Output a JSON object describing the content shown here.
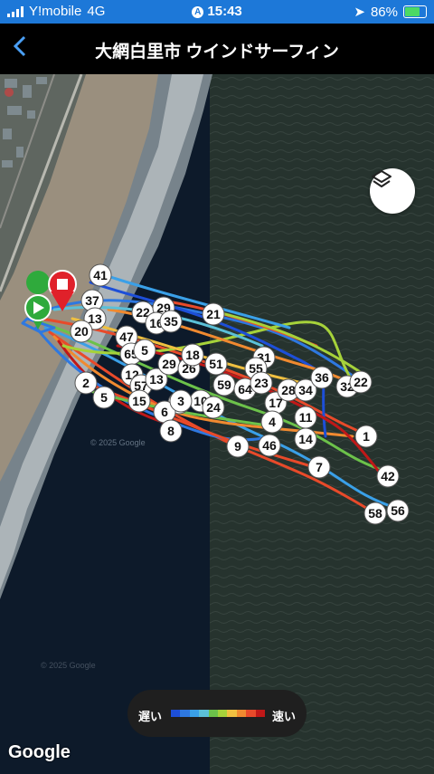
{
  "status": {
    "carrier": "Y!mobile",
    "network": "4G",
    "time": "15:43",
    "battery": "86%",
    "battery_level": 0.86
  },
  "nav": {
    "title": "大網白里市 ウインドサーフィン",
    "back_icon": "chevron-left-icon"
  },
  "legend": {
    "slow": "遅い",
    "fast": "速い",
    "colors": [
      "#1d4fd8",
      "#2e78e0",
      "#3aa0e8",
      "#5bc0d8",
      "#6cc24a",
      "#a6d23a",
      "#f0c040",
      "#f08a30",
      "#e84a2a",
      "#c01818"
    ]
  },
  "map": {
    "attribution": "Google",
    "layer_icon": "layers-icon",
    "start_icon": "play-flag-icon",
    "end_icon": "stop-flag-icon"
  },
  "lap_markers": [
    "41",
    "37",
    "13",
    "20",
    "22",
    "29",
    "16",
    "35",
    "21",
    "47",
    "65",
    "5",
    "2",
    "12",
    "57",
    "15",
    "13",
    "29",
    "26",
    "18",
    "51",
    "3",
    "10",
    "31",
    "55",
    "59",
    "64",
    "17",
    "23",
    "28",
    "34",
    "36",
    "32",
    "22",
    "1",
    "11",
    "14",
    "4",
    "46",
    "9",
    "7",
    "6",
    "8",
    "24",
    "42",
    "58",
    "56",
    "5",
    "3"
  ],
  "colors": {
    "status_bar": "#1d78d8",
    "accent": "#4a9ff5",
    "start": "#2faa3c",
    "end": "#e0212a"
  }
}
